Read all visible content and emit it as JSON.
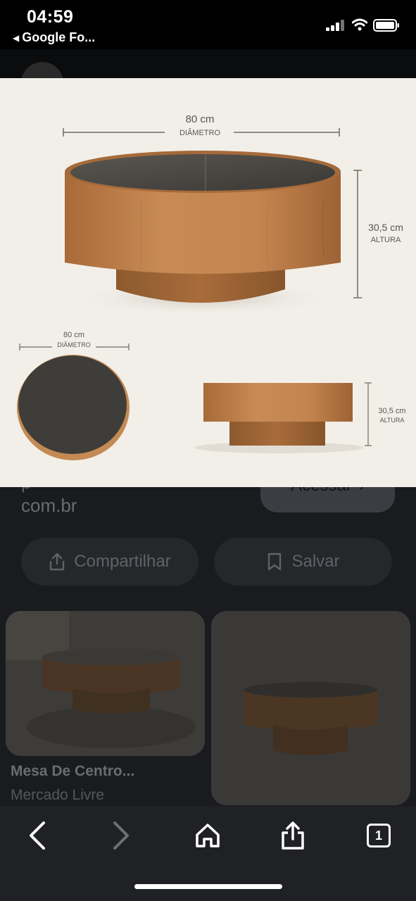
{
  "status_bar": {
    "time": "04:59",
    "back_app_label": "Google Fo..."
  },
  "product": {
    "top_width_value": "80 cm",
    "top_width_label": "DIÂMETRO",
    "top_height_value": "30,5 cm",
    "top_height_label": "ALTURA",
    "bottom_left_value": "80 cm",
    "bottom_left_label": "DIÂMETRO",
    "bottom_right_value": "30,5 cm",
    "bottom_right_label": "ALTURA"
  },
  "page": {
    "url_fragment": "com.br",
    "access_button": "Acessar",
    "share_button": "Compartilhar",
    "save_button": "Salvar",
    "result_title": "Mesa De Centro...",
    "result_source": "Mercado Livre"
  },
  "toolbar": {
    "tab_count": "1"
  },
  "colors": {
    "wood": "#b97a45",
    "glass": "#4a4843",
    "toolbar_bg": "#202124"
  }
}
